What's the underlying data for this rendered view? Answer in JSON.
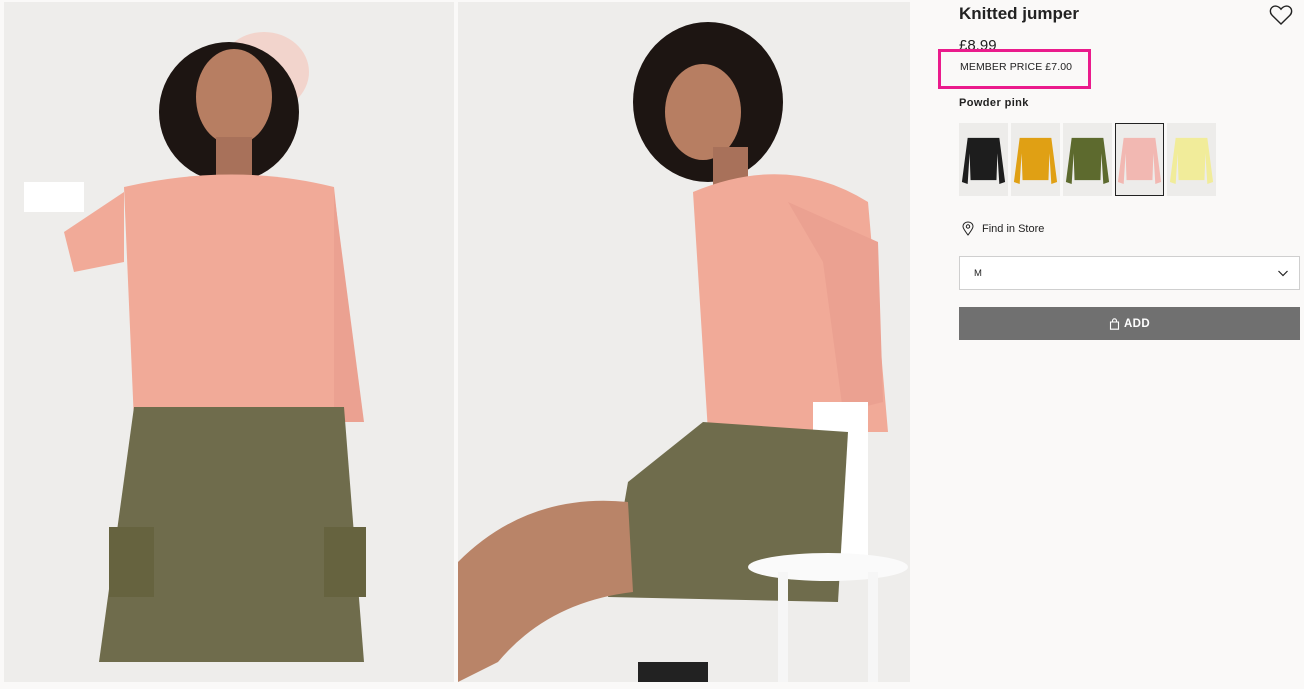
{
  "product": {
    "title": "Knitted jumper",
    "price": "£8.99",
    "member_price": "MEMBER PRICE £7.00",
    "color_name": "Powder pink",
    "highlight_color": "#ea1b8c"
  },
  "swatches": [
    {
      "name": "black",
      "color": "#1d1d1d"
    },
    {
      "name": "mustard",
      "color": "#e0a014"
    },
    {
      "name": "khaki",
      "color": "#5d6a2e"
    },
    {
      "name": "powder-pink",
      "color": "#f2b8b2",
      "selected": true
    },
    {
      "name": "light-yellow",
      "color": "#f1ec9a"
    }
  ],
  "store": {
    "find_label": "Find in Store",
    "icon": "location-pin-icon"
  },
  "size_select": {
    "value": "M",
    "icon": "chevron-down-icon"
  },
  "add_button": {
    "label": "ADD",
    "icon": "bag-icon",
    "color": "#707070"
  },
  "wishlist": {
    "icon": "heart-icon"
  },
  "gallery": [
    {
      "alt": "model-front-photo"
    },
    {
      "alt": "model-side-photo"
    }
  ]
}
